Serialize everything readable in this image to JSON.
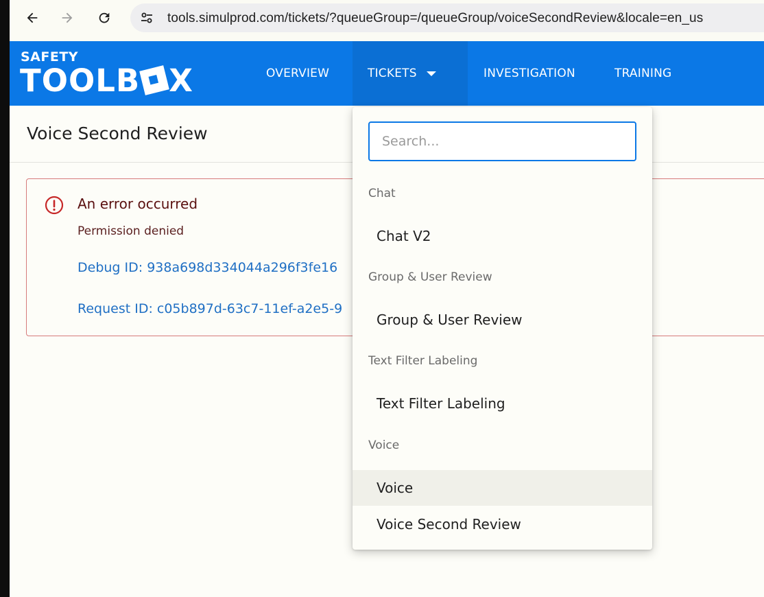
{
  "browser": {
    "url": "tools.simulprod.com/tickets/?queueGroup=/queueGroup/voiceSecondReview&locale=en_us",
    "back_icon": "arrow-left-icon",
    "forward_icon": "arrow-right-icon",
    "reload_icon": "reload-icon",
    "site_info_icon": "tune-icon"
  },
  "header": {
    "logo_top": "SAFETY",
    "logo_main_before": "TOOLB",
    "logo_main_after": "X",
    "nav": [
      {
        "label": "OVERVIEW"
      },
      {
        "label": "TICKETS"
      },
      {
        "label": "INVESTIGATION"
      },
      {
        "label": "TRAINING"
      }
    ],
    "brand_color": "#0b78e6"
  },
  "page": {
    "title": "Voice Second Review"
  },
  "error": {
    "title": "An error occurred",
    "message": "Permission denied",
    "debug_id": "Debug ID: 938a698d334044a296f3fe16",
    "request_id": "Request ID: c05b897d-63c7-11ef-a2e5-9",
    "icon": "error-circle-icon",
    "color": "#d67a7a"
  },
  "dropdown": {
    "search_placeholder": "Search...",
    "groups": [
      {
        "heading": "Chat",
        "items": [
          "Chat V2"
        ]
      },
      {
        "heading": "Group & User Review",
        "items": [
          "Group & User Review"
        ]
      },
      {
        "heading": "Text Filter Labeling",
        "items": [
          "Text Filter Labeling"
        ]
      },
      {
        "heading": "Voice",
        "items": [
          "Voice",
          "Voice Second Review"
        ]
      }
    ],
    "hovered_item": "Voice"
  }
}
